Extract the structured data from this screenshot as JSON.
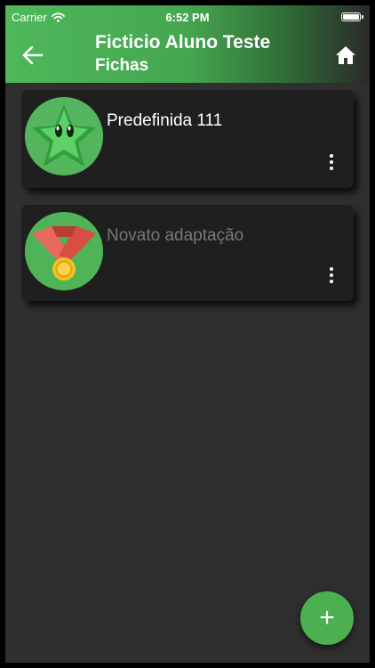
{
  "status_bar": {
    "carrier": "Carrier",
    "time": "6:52 PM",
    "battery_level": 1.0
  },
  "header": {
    "title": "Ficticio Aluno Teste",
    "subtitle": "Fichas",
    "back_icon": "arrow-left-icon",
    "home_icon": "home-icon",
    "color": "#4fb85a"
  },
  "cards": [
    {
      "name": "Predefinida 111",
      "icon": "green-star-icon",
      "active": true,
      "menu_icon": "more-vertical-icon"
    },
    {
      "name": "Novato adaptação",
      "icon": "medal-icon",
      "active": false,
      "menu_icon": "more-vertical-icon"
    }
  ],
  "fab": {
    "label": "+",
    "icon": "add-icon",
    "color": "#4caf50"
  },
  "colors": {
    "background": "#2f2f2f",
    "card": "#1f1f1f",
    "muted_text": "#777777"
  }
}
